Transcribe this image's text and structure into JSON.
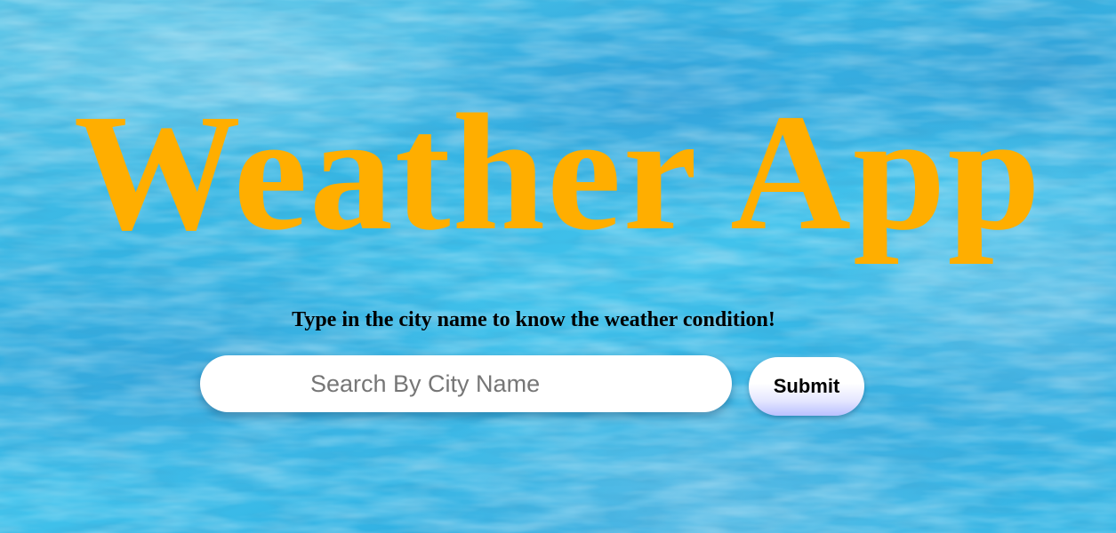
{
  "header": {
    "title": "Weather App",
    "subtitle": "Type in the city name to know the weather condition!"
  },
  "search": {
    "placeholder": "Search By City Name",
    "value": "",
    "submit_label": "Submit"
  },
  "colors": {
    "title": "#ffae00",
    "water": "#35b6e4",
    "subtitle": "#000000"
  }
}
